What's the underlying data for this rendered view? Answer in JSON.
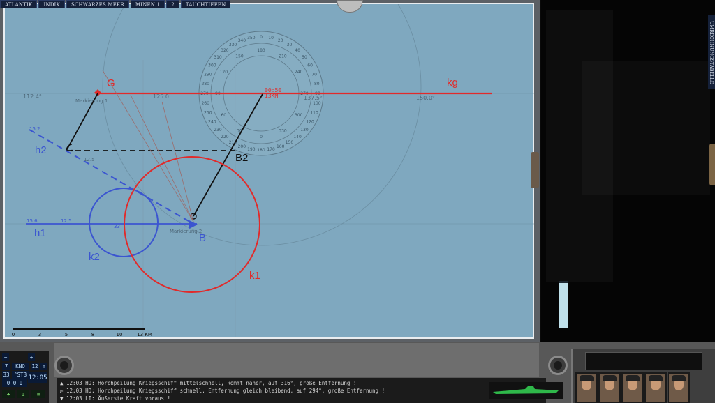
{
  "tabs": [
    "ATLANTIK",
    "INDIK",
    "SCHWARZES MEER",
    "MINEN 1",
    "2",
    "TAUCHTIEFEN"
  ],
  "side_tab": "UMRECHNUNGSTABELLE",
  "map": {
    "labels": {
      "g": "G",
      "kg": "kg",
      "h2": "h2",
      "h1": "h1",
      "k2": "k2",
      "k1": "k1",
      "b": "B",
      "b2": "B2"
    },
    "bearing_labels": [
      "112.4°",
      "125.0",
      "137.5°",
      "150.0°"
    ],
    "small_labels": [
      "15.2",
      "12.5",
      "15.6",
      "12.5",
      "33"
    ],
    "markers": [
      "Markierung 1",
      "Markierung 2"
    ],
    "time_readout": "00:50",
    "distance_readout": "13KM",
    "compass_outer_ticks": [
      "0",
      "10",
      "20",
      "30",
      "40",
      "50",
      "60",
      "70",
      "80",
      "90",
      "100",
      "110",
      "120",
      "130",
      "140",
      "150",
      "160",
      "170",
      "180",
      "190",
      "200",
      "210",
      "220",
      "230",
      "240",
      "250",
      "260",
      "270",
      "280",
      "290",
      "300",
      "310",
      "320",
      "330",
      "340",
      "350"
    ],
    "compass_inner_ticks": [
      "180",
      "210",
      "240",
      "270",
      "300",
      "330",
      "0",
      "30",
      "60",
      "90",
      "120",
      "150"
    ],
    "scale_ticks": [
      "0",
      "3",
      "5",
      "8",
      "10",
      "13 KM"
    ]
  },
  "controls": {
    "knots_value": "7",
    "knots_label": "KNO",
    "depth_value": "12",
    "depth_unit": "m",
    "heading": "33",
    "heading_unit": "°STB",
    "clock": "12:05",
    "counter": "0 0 0"
  },
  "messages": [
    {
      "time": "12:03",
      "speaker": "HO:",
      "text": "Horchpeilung Kriegsschiff mittelschnell, kommt näher, auf 316°, große Entfernung !"
    },
    {
      "time": "12:03",
      "speaker": "HO:",
      "text": "Horchpeilung Kriegsschiff schnell, Entfernung gleich bleibend, auf 294°, große Entfernung !"
    },
    {
      "time": "12:03",
      "speaker": "LI:",
      "text": "Äußerste Kraft voraus !"
    }
  ],
  "level_fill": 0.95,
  "colors": {
    "map_water": "#7fa8bf",
    "red_lines": "#e12a2a",
    "blue_lines": "#3b55d0"
  }
}
